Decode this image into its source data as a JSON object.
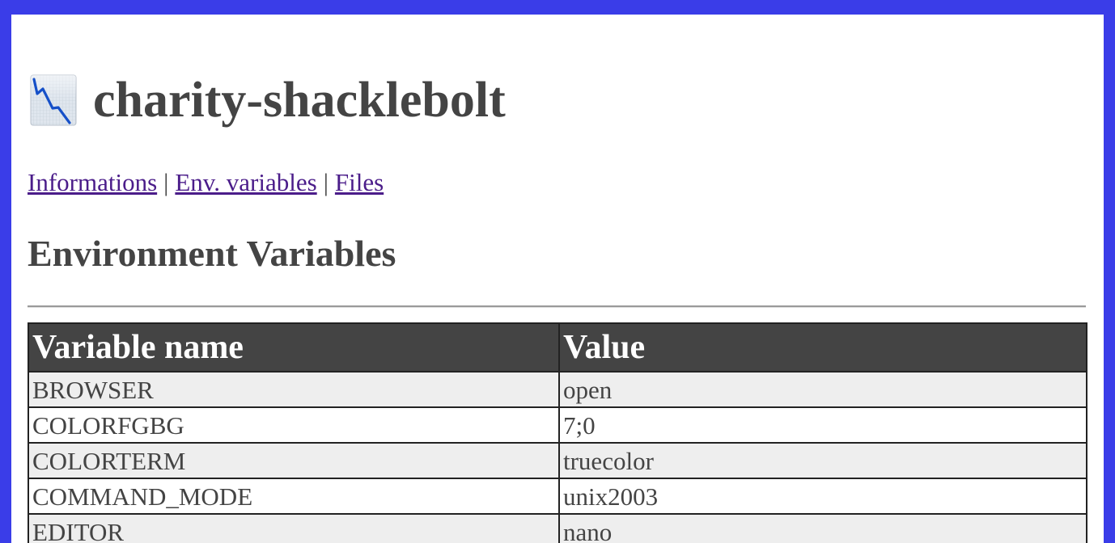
{
  "header": {
    "title": "charity-shacklebolt",
    "logo_icon": "chart-down-icon"
  },
  "nav": {
    "links": [
      "Informations",
      "Env. variables",
      "Files"
    ],
    "separator": "|"
  },
  "section": {
    "heading": "Environment Variables"
  },
  "table": {
    "headers": [
      "Variable name",
      "Value"
    ],
    "rows": [
      [
        "BROWSER",
        "open"
      ],
      [
        "COLORFGBG",
        "7;0"
      ],
      [
        "COLORTERM",
        "truecolor"
      ],
      [
        "COMMAND_MODE",
        "unix2003"
      ],
      [
        "EDITOR",
        "nano"
      ]
    ]
  },
  "colors": {
    "frame": "#3a3de8",
    "text": "#444444",
    "link": "#4b1d8a",
    "header_bg": "#444444",
    "row_alt": "#eeeeee"
  }
}
